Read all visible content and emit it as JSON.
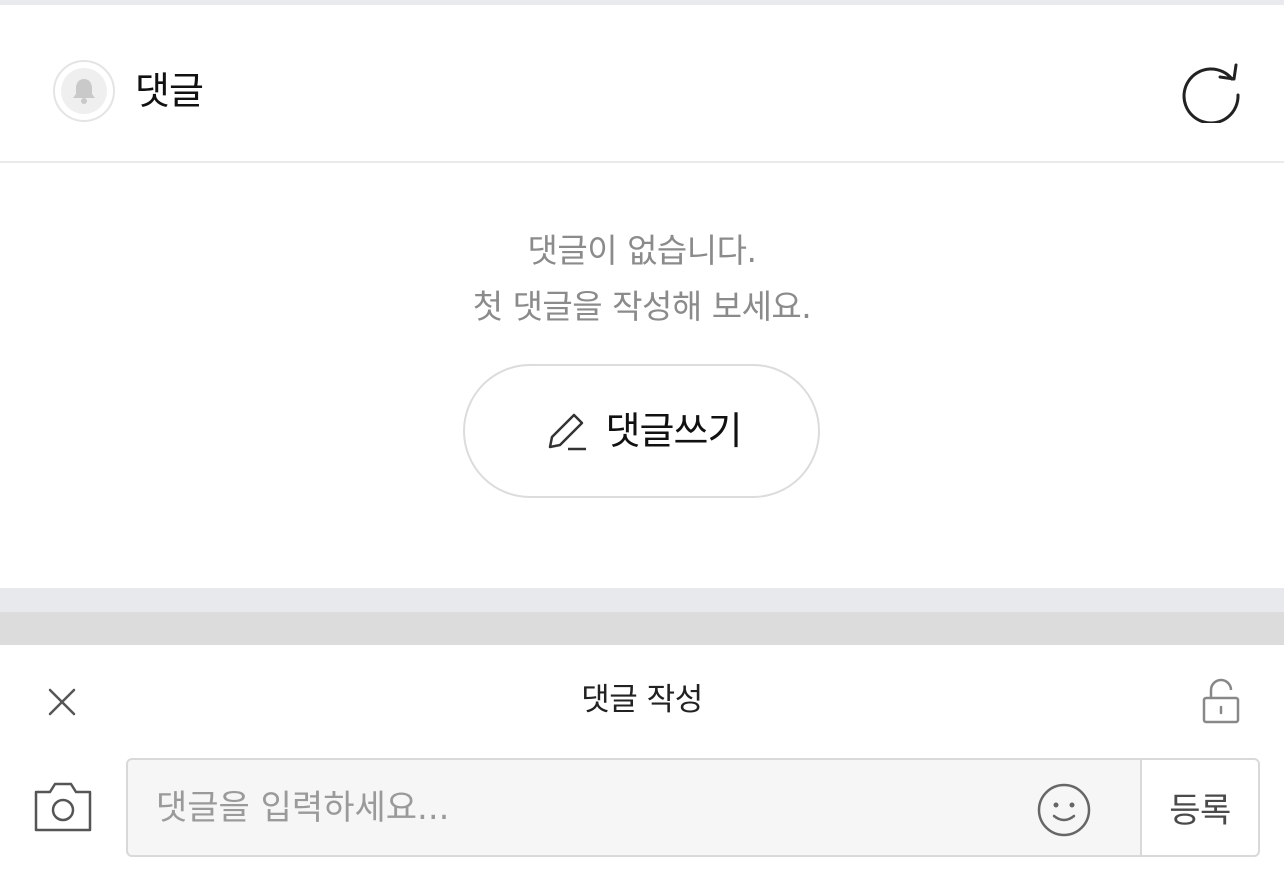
{
  "header": {
    "title": "댓글",
    "avatar_icon": "bell-icon",
    "refresh_icon": "refresh-icon"
  },
  "empty_state": {
    "line1": "댓글이 없습니다.",
    "line2": "첫 댓글을 작성해 보세요.",
    "write_button_label": "댓글쓰기",
    "write_button_icon": "pencil-icon"
  },
  "composer": {
    "title": "댓글 작성",
    "close_icon": "close-icon",
    "lock_icon": "unlock-icon",
    "camera_icon": "camera-icon",
    "input_placeholder": "댓글을 입력하세요...",
    "input_value": "",
    "emoji_icon": "emoji-icon",
    "submit_label": "등록"
  },
  "colors": {
    "muted_text": "#8b8b8b",
    "border": "#d9d9d9",
    "section_gap": "#e8e9ed"
  }
}
